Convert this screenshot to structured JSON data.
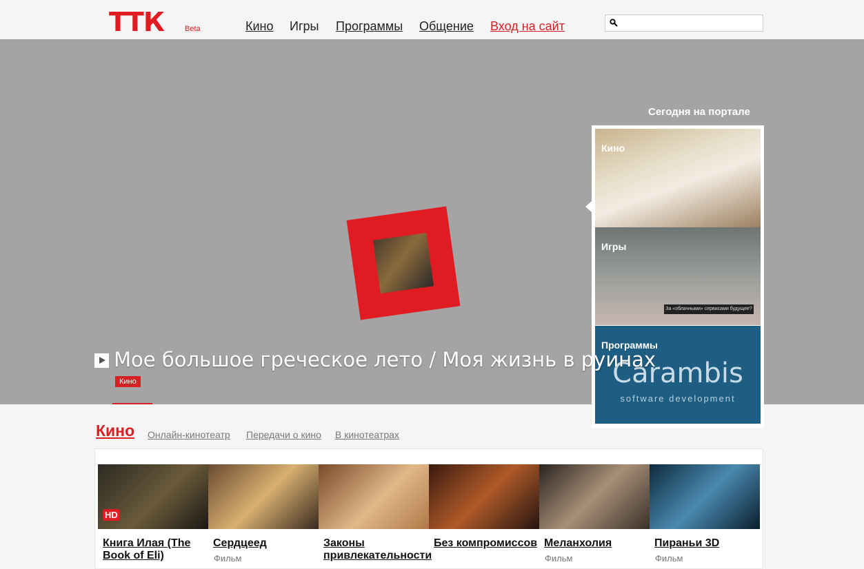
{
  "header": {
    "logo": "ТТК",
    "beta": "Beta",
    "nav": [
      {
        "label": "Кино"
      },
      {
        "label": "Игры"
      },
      {
        "label": "Программы"
      },
      {
        "label": "Общение"
      },
      {
        "label": "Вход на сайт"
      }
    ],
    "search": {
      "placeholder": "",
      "value": ""
    }
  },
  "hero": {
    "title": "Мое большое греческое лето / Моя жизнь в руинах",
    "tag": "Кино"
  },
  "sidebar": {
    "heading": "Сегодня на портале",
    "tiles": [
      {
        "label": "Кино"
      },
      {
        "label": "Игры",
        "caption": "За «облачными» сервисами будущее?"
      },
      {
        "label": "Программы",
        "brand": "Carambis",
        "brand_sub": "software development"
      }
    ]
  },
  "section": {
    "title": "Кино",
    "tabs": [
      "Онлайн-кинотеатр",
      "Передачи о кино",
      "В кинотеатрах"
    ],
    "films": [
      {
        "name": "Книга Илая (The Book of Eli)",
        "kind": "",
        "badge": "HD"
      },
      {
        "name": "Сердцеед",
        "kind": "Фильм"
      },
      {
        "name": "Законы привлекательности",
        "kind": ""
      },
      {
        "name": "Без компромиссов",
        "kind": ""
      },
      {
        "name": "Меланхолия",
        "kind": "Фильм"
      },
      {
        "name": "Пираньи 3D",
        "kind": "Фильм"
      }
    ]
  },
  "colors": {
    "accent": "#e11b22",
    "hero_bg": "#a4a4a4",
    "page_bg": "#f5f5f5"
  }
}
